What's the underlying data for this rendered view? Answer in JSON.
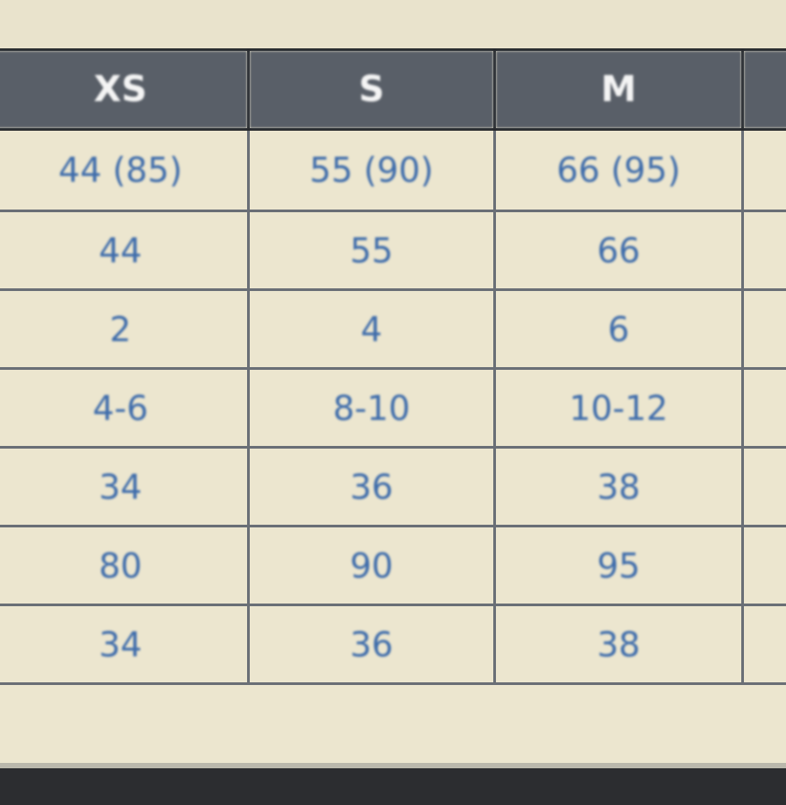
{
  "table": {
    "headers": [
      "XS",
      "S",
      "M",
      ""
    ],
    "rows": [
      [
        "44 (85)",
        "55 (90)",
        "66 (95)",
        ""
      ],
      [
        "44",
        "55",
        "66",
        ""
      ],
      [
        "2",
        "4",
        "6",
        ""
      ],
      [
        "4-6",
        "8-10",
        "10-12",
        ""
      ],
      [
        "34",
        "36",
        "38",
        ""
      ],
      [
        "80",
        "90",
        "95",
        ""
      ],
      [
        "34",
        "36",
        "38",
        ""
      ]
    ]
  },
  "colors": {
    "header_background": "#595f68",
    "cell_background": "#ece6cf",
    "cell_text": "#3e6cab",
    "grid_line": "#6a6f76"
  }
}
